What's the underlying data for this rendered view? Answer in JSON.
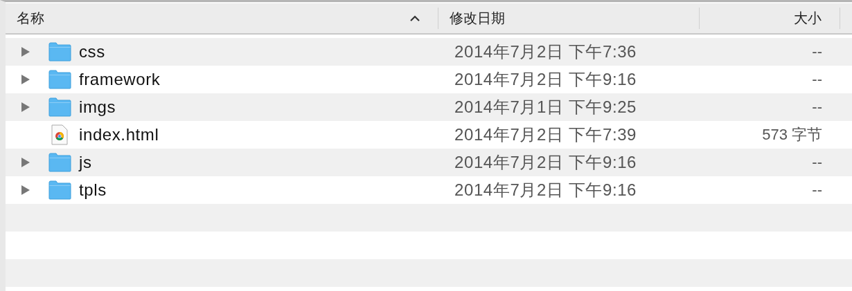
{
  "columns": [
    {
      "label": "名称",
      "sorted": true
    },
    {
      "label": "修改日期",
      "sorted": false
    },
    {
      "label": "大小",
      "sorted": false
    }
  ],
  "rows": [
    {
      "kind": "folder",
      "name": "css",
      "expanded": false,
      "date": "2014年7月2日 下午7:36",
      "size": "--"
    },
    {
      "kind": "folder",
      "name": "framework",
      "expanded": false,
      "date": "2014年7月2日 下午9:16",
      "size": "--"
    },
    {
      "kind": "folder",
      "name": "imgs",
      "expanded": false,
      "date": "2014年7月1日 下午9:25",
      "size": "--"
    },
    {
      "kind": "file",
      "name": "index.html",
      "date": "2014年7月2日 下午7:39",
      "size": "573 字节"
    },
    {
      "kind": "folder",
      "name": "js",
      "expanded": false,
      "date": "2014年7月2日 下午9:16",
      "size": "--"
    },
    {
      "kind": "folder",
      "name": "tpls",
      "expanded": false,
      "date": "2014年7月2日 下午9:16",
      "size": "--"
    }
  ]
}
